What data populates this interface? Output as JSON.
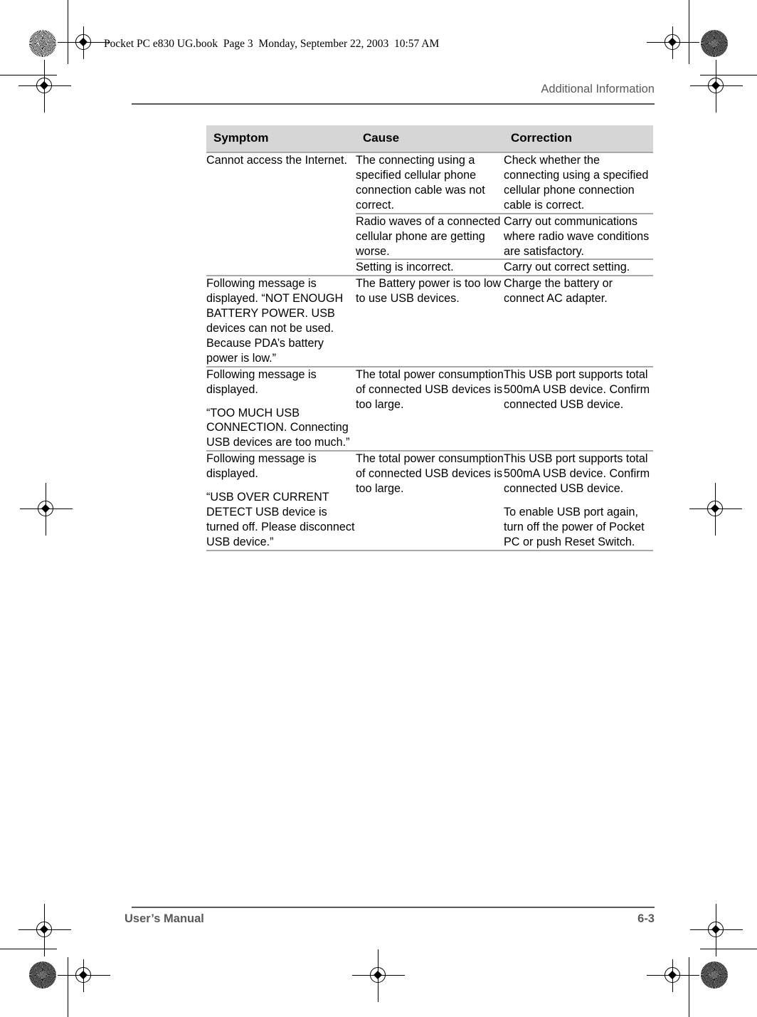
{
  "page": {
    "book_stamp": "Pocket PC e830 UG.book  Page 3  Monday, September 22, 2003  10:57 AM",
    "running_head": "Additional Information",
    "footer_left": "User’s Manual",
    "footer_page": "6-3",
    "header_bg": "#d6d6d6",
    "rule_color": "#58595b",
    "row_rule_color": "#a9a9a9"
  },
  "table": {
    "columns": [
      "Symptom",
      "Cause",
      "Correction"
    ],
    "groups": [
      {
        "symptom": [
          "Cannot access the Internet."
        ],
        "rows": [
          {
            "cause": [
              "The connecting using a specified cellular phone connection cable was not correct."
            ],
            "correction": [
              "Check whether the connecting using a specified cellular phone connection cable is correct."
            ]
          },
          {
            "cause": [
              "Radio waves of a connected cellular phone are getting worse."
            ],
            "correction": [
              "Carry out communications where radio wave conditions are satisfactory."
            ]
          },
          {
            "cause": [
              "Setting is incorrect."
            ],
            "correction": [
              "Carry out correct setting."
            ]
          }
        ]
      },
      {
        "symptom": [
          "Following message is displayed. “NOT ENOUGH BATTERY POWER. USB devices can not be used. Because PDA’s battery power is low.”"
        ],
        "rows": [
          {
            "cause": [
              "The Battery power is too low to use USB devices."
            ],
            "correction": [
              "Charge the battery or connect AC adapter."
            ]
          }
        ]
      },
      {
        "symptom": [
          "Following message is displayed.",
          "“TOO MUCH USB CONNECTION. Connecting USB devices are too much.”"
        ],
        "rows": [
          {
            "cause": [
              "The total power consumption of connected USB devices is too large."
            ],
            "correction": [
              "This USB port supports total 500mA USB device. Confirm connected USB device."
            ]
          }
        ]
      },
      {
        "symptom": [
          "Following message is displayed.",
          "“USB OVER CURRENT DETECT USB device is turned off. Please disconnect USB device.”"
        ],
        "rows": [
          {
            "cause": [
              "The total power consumption of connected USB devices is too large."
            ],
            "correction": [
              "This USB port supports total 500mA USB device. Confirm connected USB device.",
              "To enable USB port again, turn off the power of Pocket PC or push Reset Switch."
            ]
          }
        ]
      }
    ]
  }
}
